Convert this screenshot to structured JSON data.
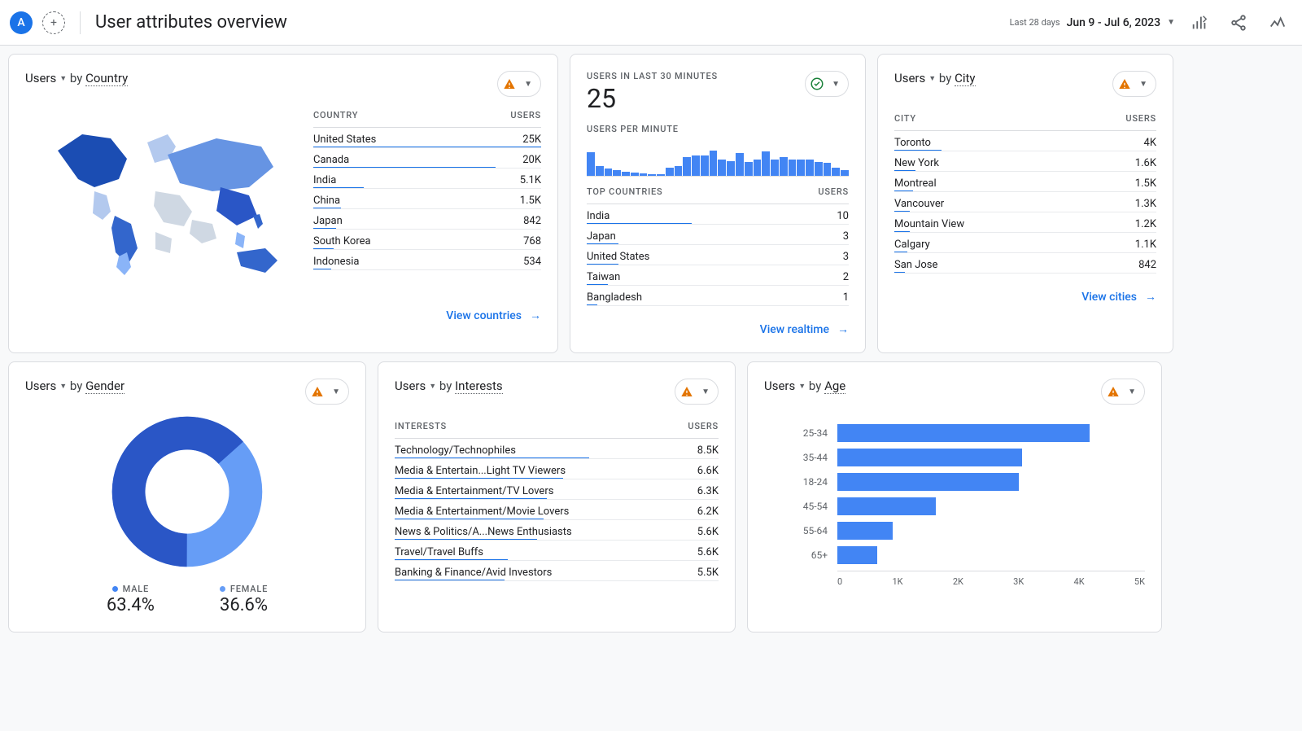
{
  "header": {
    "letter": "A",
    "title": "User attributes overview",
    "date": {
      "prefix": "Last 28 days",
      "range": "Jun 9 - Jul 6, 2023"
    }
  },
  "card_country": {
    "metric": "Users",
    "by": "by",
    "dimension": "Country",
    "head_dim": "COUNTRY",
    "head_val": "USERS",
    "rows": [
      {
        "label": "United States",
        "value": "25K",
        "w": 100
      },
      {
        "label": "Canada",
        "value": "20K",
        "w": 80
      },
      {
        "label": "India",
        "value": "5.1K",
        "w": 22
      },
      {
        "label": "China",
        "value": "1.5K",
        "w": 12
      },
      {
        "label": "Japan",
        "value": "842",
        "w": 10
      },
      {
        "label": "South Korea",
        "value": "768",
        "w": 9
      },
      {
        "label": "Indonesia",
        "value": "534",
        "w": 8
      }
    ],
    "footer": "View countries"
  },
  "card_realtime": {
    "label1": "USERS IN LAST 30 MINUTES",
    "big": "25",
    "label2": "USERS PER MINUTE",
    "head_dim": "TOP COUNTRIES",
    "head_val": "USERS",
    "rows": [
      {
        "label": "India",
        "value": "10",
        "w": 40
      },
      {
        "label": "Japan",
        "value": "3",
        "w": 12
      },
      {
        "label": "United States",
        "value": "3",
        "w": 12
      },
      {
        "label": "Taiwan",
        "value": "2",
        "w": 8
      },
      {
        "label": "Bangladesh",
        "value": "1",
        "w": 4
      }
    ],
    "footer": "View realtime"
  },
  "card_city": {
    "metric": "Users",
    "by": "by",
    "dimension": "City",
    "head_dim": "CITY",
    "head_val": "USERS",
    "rows": [
      {
        "label": "Toronto",
        "value": "4K",
        "w": 18
      },
      {
        "label": "New York",
        "value": "1.6K",
        "w": 8
      },
      {
        "label": "Montreal",
        "value": "1.5K",
        "w": 7
      },
      {
        "label": "Vancouver",
        "value": "1.3K",
        "w": 6
      },
      {
        "label": "Mountain View",
        "value": "1.2K",
        "w": 6
      },
      {
        "label": "Calgary",
        "value": "1.1K",
        "w": 5
      },
      {
        "label": "San Jose",
        "value": "842",
        "w": 4
      }
    ],
    "footer": "View cities"
  },
  "card_gender": {
    "metric": "Users",
    "by": "by",
    "dimension": "Gender",
    "male": {
      "label": "MALE",
      "value": "63.4%",
      "color": "#4285f4"
    },
    "female": {
      "label": "FEMALE",
      "value": "36.6%",
      "color": "#669df6"
    }
  },
  "card_interests": {
    "metric": "Users",
    "by": "by",
    "dimension": "Interests",
    "head_dim": "INTERESTS",
    "head_val": "USERS",
    "rows": [
      {
        "label": "Technology/Technophiles",
        "value": "8.5K",
        "w": 60
      },
      {
        "label": "Media & Entertain...Light TV Viewers",
        "value": "6.6K",
        "w": 52
      },
      {
        "label": "Media & Entertainment/TV Lovers",
        "value": "6.3K",
        "w": 47
      },
      {
        "label": "Media & Entertainment/Movie Lovers",
        "value": "6.2K",
        "w": 46
      },
      {
        "label": "News & Politics/A...News Enthusiasts",
        "value": "5.6K",
        "w": 44
      },
      {
        "label": "Travel/Travel Buffs",
        "value": "5.6K",
        "w": 35
      },
      {
        "label": "Banking & Finance/Avid Investors",
        "value": "5.5K",
        "w": 34
      }
    ]
  },
  "card_age": {
    "metric": "Users",
    "by": "by",
    "dimension": "Age",
    "rows": [
      {
        "label": "25-34",
        "w": 82
      },
      {
        "label": "35-44",
        "w": 60
      },
      {
        "label": "18-24",
        "w": 59
      },
      {
        "label": "45-54",
        "w": 32
      },
      {
        "label": "55-64",
        "w": 18
      },
      {
        "label": "65+",
        "w": 13
      }
    ],
    "axis": [
      "0",
      "1K",
      "2K",
      "3K",
      "4K",
      "5K"
    ]
  },
  "chart_data": [
    {
      "type": "bar",
      "title": "Users by Country",
      "categories": [
        "United States",
        "Canada",
        "India",
        "China",
        "Japan",
        "South Korea",
        "Indonesia"
      ],
      "values": [
        25000,
        20000,
        5100,
        1500,
        842,
        768,
        534
      ]
    },
    {
      "type": "bar",
      "title": "Users in last 30 minutes — top countries",
      "categories": [
        "India",
        "Japan",
        "United States",
        "Taiwan",
        "Bangladesh"
      ],
      "values": [
        10,
        3,
        3,
        2,
        1
      ]
    },
    {
      "type": "bar",
      "title": "Users by City",
      "categories": [
        "Toronto",
        "New York",
        "Montreal",
        "Vancouver",
        "Mountain View",
        "Calgary",
        "San Jose"
      ],
      "values": [
        4000,
        1600,
        1500,
        1300,
        1200,
        1100,
        842
      ]
    },
    {
      "type": "pie",
      "title": "Users by Gender",
      "categories": [
        "Male",
        "Female"
      ],
      "values": [
        63.4,
        36.6
      ]
    },
    {
      "type": "bar",
      "title": "Users by Interests",
      "categories": [
        "Technology/Technophiles",
        "Media & Entertainment/Light TV Viewers",
        "Media & Entertainment/TV Lovers",
        "Media & Entertainment/Movie Lovers",
        "News & Politics/Avid News Enthusiasts",
        "Travel/Travel Buffs",
        "Banking & Finance/Avid Investors"
      ],
      "values": [
        8500,
        6600,
        6300,
        6200,
        5600,
        5600,
        5500
      ]
    },
    {
      "type": "bar",
      "title": "Users by Age",
      "xlabel": "Users",
      "xlim": [
        0,
        5000
      ],
      "categories": [
        "25-34",
        "35-44",
        "18-24",
        "45-54",
        "55-64",
        "65+"
      ],
      "values": [
        4100,
        3000,
        2950,
        1600,
        900,
        650
      ]
    }
  ],
  "spark_bars": [
    70,
    30,
    22,
    18,
    12,
    10,
    8,
    6,
    4,
    25,
    30,
    55,
    60,
    62,
    75,
    50,
    45,
    68,
    42,
    48,
    72,
    50,
    55,
    50,
    48,
    50,
    42,
    38,
    25,
    18
  ]
}
